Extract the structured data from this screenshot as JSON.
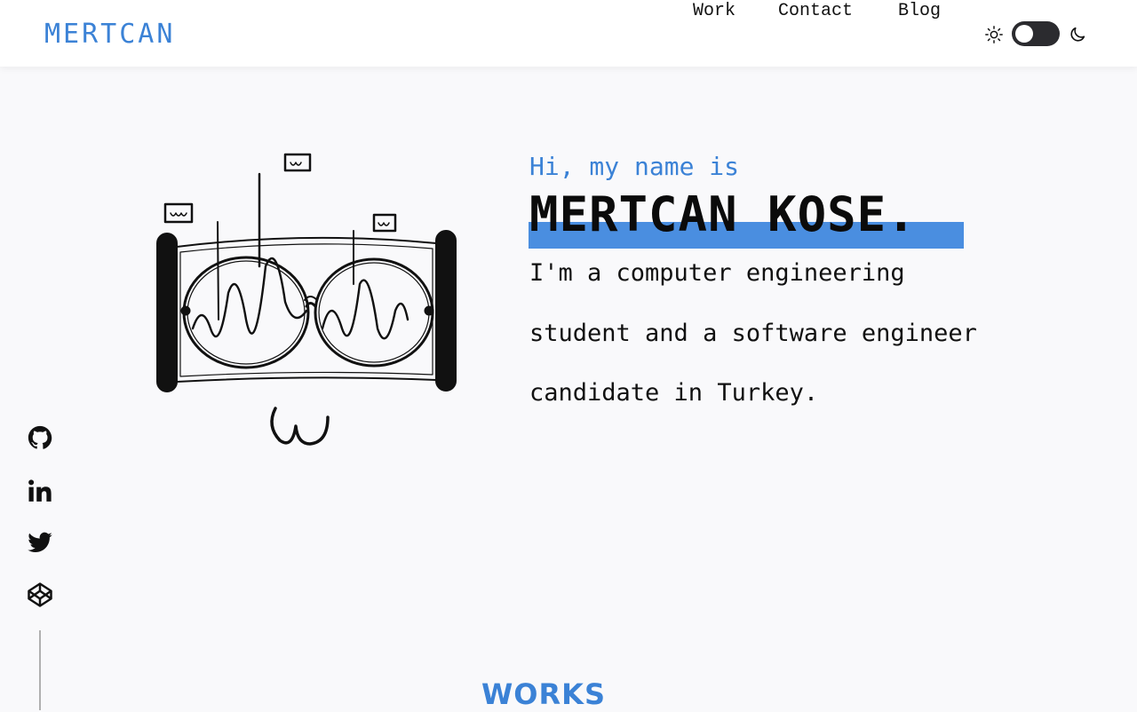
{
  "brand": {
    "name": "MERTCAN"
  },
  "nav": {
    "links": [
      {
        "label": "Work"
      },
      {
        "label": "Contact"
      },
      {
        "label": "Blog"
      }
    ]
  },
  "theme": {
    "mode": "light",
    "sun_icon": "sun-icon",
    "moon_icon": "moon-icon"
  },
  "hero": {
    "greeting": "Hi, my name is",
    "name": "MERTCAN KOSE.",
    "bio": "I'm a computer engineering student and a software engineer candidate in Turkey."
  },
  "social": {
    "icons": [
      "github-icon",
      "linkedin-icon",
      "twitter-icon",
      "codepen-icon"
    ]
  },
  "sections": {
    "works_title": "WORKS"
  },
  "colors": {
    "accent": "#3b82d6",
    "highlight": "#4a8ee0",
    "background": "#f9f9fb",
    "text": "#111111"
  }
}
